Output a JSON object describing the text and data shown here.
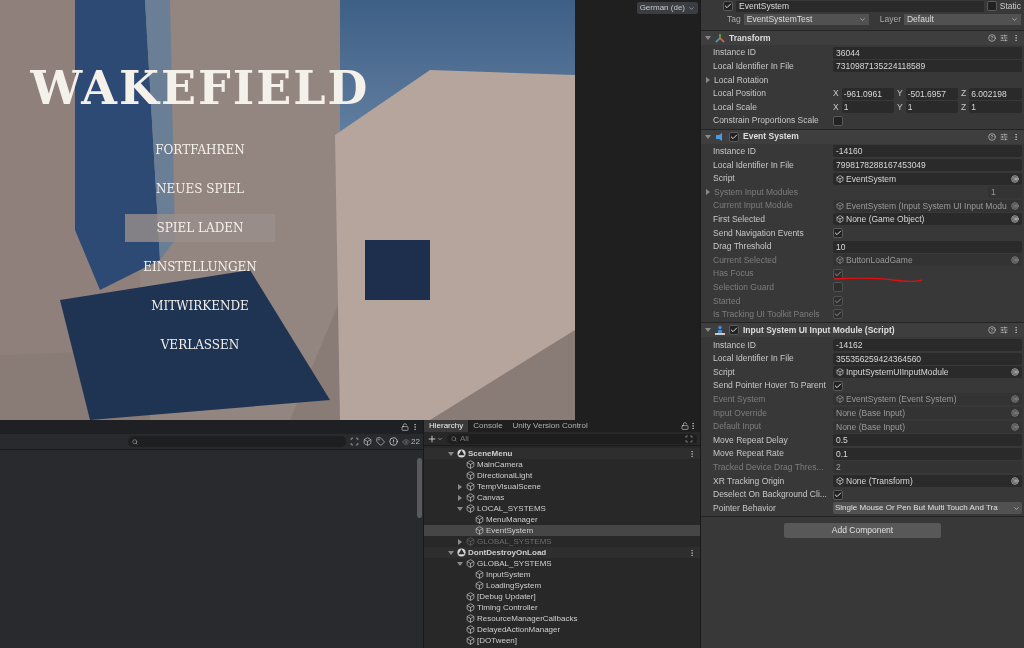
{
  "game_view": {
    "title": "WAKEFIELD",
    "menu": [
      {
        "label": "FORTFAHREN",
        "selected": false
      },
      {
        "label": "NEUES SPIEL",
        "selected": false
      },
      {
        "label": "SPIEL LADEN",
        "selected": true
      },
      {
        "label": "EINSTELLUNGEN",
        "selected": false
      },
      {
        "label": "MITWIRKENDE",
        "selected": false
      },
      {
        "label": "VERLASSEN",
        "selected": false
      }
    ],
    "language_dropdown": "German (de)"
  },
  "project_panel": {
    "count": "22"
  },
  "hierarchy": {
    "tabs": [
      {
        "label": "Hierarchy",
        "selected": true
      },
      {
        "label": "Console",
        "selected": false
      },
      {
        "label": "Unity Version Control",
        "selected": false
      }
    ],
    "search_placeholder": "All",
    "items": [
      {
        "label": "SceneMenu",
        "kind": "scene",
        "expanded": true,
        "selected": false,
        "disabled": false,
        "children": [
          {
            "label": "MainCamera",
            "kind": "object",
            "selected": false,
            "disabled": false
          },
          {
            "label": "DirectionalLight",
            "kind": "object",
            "selected": false,
            "disabled": false
          },
          {
            "label": "TempVisualScene",
            "kind": "object",
            "expanded": false,
            "selected": false,
            "disabled": false
          },
          {
            "label": "Canvas",
            "kind": "object",
            "expanded": false,
            "selected": false,
            "disabled": false
          },
          {
            "label": "LOCAL_SYSTEMS",
            "kind": "object",
            "expanded": true,
            "selected": false,
            "disabled": false,
            "children": [
              {
                "label": "MenuManager",
                "kind": "object",
                "selected": false,
                "disabled": false
              },
              {
                "label": "EventSystem",
                "kind": "object",
                "selected": true,
                "disabled": false
              }
            ]
          },
          {
            "label": "GLOBAL_SYSTEMS",
            "kind": "object",
            "expanded": false,
            "selected": false,
            "disabled": true
          }
        ]
      },
      {
        "label": "DontDestroyOnLoad",
        "kind": "scene",
        "expanded": true,
        "selected": false,
        "disabled": false,
        "children": [
          {
            "label": "GLOBAL_SYSTEMS",
            "kind": "object",
            "expanded": true,
            "selected": false,
            "disabled": false,
            "children": [
              {
                "label": "InputSystem",
                "kind": "object",
                "selected": false,
                "disabled": false
              },
              {
                "label": "LoadingSystem",
                "kind": "object",
                "selected": false,
                "disabled": false
              }
            ]
          },
          {
            "label": "[Debug Updater]",
            "kind": "object",
            "selected": false,
            "disabled": false
          },
          {
            "label": "Timing Controller",
            "kind": "object",
            "selected": false,
            "disabled": false
          },
          {
            "label": "ResourceManagerCallbacks",
            "kind": "object",
            "selected": false,
            "disabled": false
          },
          {
            "label": "DelayedActionManager",
            "kind": "object",
            "selected": false,
            "disabled": false
          },
          {
            "label": "[DOTween]",
            "kind": "object",
            "selected": false,
            "disabled": false
          }
        ]
      }
    ]
  },
  "inspector": {
    "active": true,
    "object_name": "EventSystem",
    "static": false,
    "static_label": "Static",
    "tag_label": "Tag",
    "tag": "EventSystemTest",
    "layer_label": "Layer",
    "layer": "Default",
    "components": [
      {
        "title": "Transform",
        "kind": "transform",
        "rows": [
          {
            "kind": "field",
            "label": "Instance ID",
            "value": "36044",
            "disabled": false
          },
          {
            "kind": "field",
            "label": "Local Identifier In File",
            "value": "7310987135224118589",
            "disabled": false
          },
          {
            "kind": "foldout",
            "label": "Local Rotation",
            "disabled": false
          },
          {
            "kind": "vector",
            "label": "Local Position",
            "values": [
              {
                "axis": "X",
                "value": "-961.0961"
              },
              {
                "axis": "Y",
                "value": "-501.6957"
              },
              {
                "axis": "Z",
                "value": "6.002198"
              }
            ],
            "disabled": false
          },
          {
            "kind": "vector",
            "label": "Local Scale",
            "values": [
              {
                "axis": "X",
                "value": "1"
              },
              {
                "axis": "Y",
                "value": "1"
              },
              {
                "axis": "Z",
                "value": "1"
              }
            ],
            "disabled": false
          },
          {
            "kind": "checkbox",
            "label": "Constrain Proportions Scale",
            "checked": false,
            "disabled": false
          }
        ]
      },
      {
        "title": "Event System",
        "kind": "event",
        "enabled": true,
        "rows": [
          {
            "kind": "field",
            "label": "Instance ID",
            "value": "-14160",
            "disabled": false
          },
          {
            "kind": "field",
            "label": "Local Identifier In File",
            "value": "7998178288167453049",
            "disabled": false
          },
          {
            "kind": "object",
            "label": "Script",
            "value": "EventSystem",
            "icon": true,
            "disabled": false
          },
          {
            "kind": "foldout",
            "label": "System Input Modules",
            "value": "1",
            "disabled": true
          },
          {
            "kind": "object",
            "label": "Current Input Module",
            "value": "EventSystem (Input System UI Input Modu",
            "icon": true,
            "disabled": true
          },
          {
            "kind": "object",
            "label": "First Selected",
            "value": "None (Game Object)",
            "icon": true,
            "disabled": false
          },
          {
            "kind": "checkbox",
            "label": "Send Navigation Events",
            "checked": true,
            "disabled": false
          },
          {
            "kind": "field",
            "label": "Drag Threshold",
            "value": "10",
            "disabled": false
          },
          {
            "kind": "object",
            "label": "Current Selected",
            "value": "ButtonLoadGame",
            "icon": true,
            "disabled": true
          },
          {
            "kind": "checkbox",
            "label": "Has Focus",
            "checked": true,
            "disabled": true,
            "annotated": true
          },
          {
            "kind": "checkbox",
            "label": "Selection Guard",
            "checked": false,
            "disabled": true
          },
          {
            "kind": "checkbox",
            "label": "Started",
            "checked": true,
            "disabled": true
          },
          {
            "kind": "checkbox",
            "label": "Is Tracking UI Toolkit Panels",
            "checked": true,
            "disabled": true
          }
        ]
      },
      {
        "title": "Input System UI Input Module (Script)",
        "kind": "script",
        "enabled": true,
        "rows": [
          {
            "kind": "field",
            "label": "Instance ID",
            "value": "-14162",
            "disabled": false
          },
          {
            "kind": "field",
            "label": "Local Identifier In File",
            "value": "355356259424364560",
            "disabled": false
          },
          {
            "kind": "object",
            "label": "Script",
            "value": "InputSystemUIInputModule",
            "icon": true,
            "disabled": false
          },
          {
            "kind": "checkbox",
            "label": "Send Pointer Hover To Parent",
            "checked": true,
            "disabled": false
          },
          {
            "kind": "object",
            "label": "Event System",
            "value": "EventSystem (Event System)",
            "icon": true,
            "disabled": true
          },
          {
            "kind": "object",
            "label": "Input Override",
            "value": "None (Base Input)",
            "icon": false,
            "disabled": true
          },
          {
            "kind": "object",
            "label": "Default Input",
            "value": "None (Base Input)",
            "icon": false,
            "disabled": true
          },
          {
            "kind": "field",
            "label": "Move Repeat Delay",
            "value": "0.5",
            "disabled": false
          },
          {
            "kind": "field",
            "label": "Move Repeat Rate",
            "value": "0.1",
            "disabled": false
          },
          {
            "kind": "field",
            "label": "Tracked Device Drag Thres...",
            "value": "2",
            "disabled": true
          },
          {
            "kind": "object",
            "label": "XR Tracking Origin",
            "value": "None (Transform)",
            "icon": true,
            "disabled": false
          },
          {
            "kind": "checkbox",
            "label": "Deselect On Background Cli...",
            "checked": true,
            "disabled": false
          },
          {
            "kind": "dropdown",
            "label": "Pointer Behavior",
            "value": "Single Mouse Or Pen But Multi Touch And Tra",
            "disabled": false
          }
        ]
      }
    ],
    "add_component": "Add Component"
  }
}
